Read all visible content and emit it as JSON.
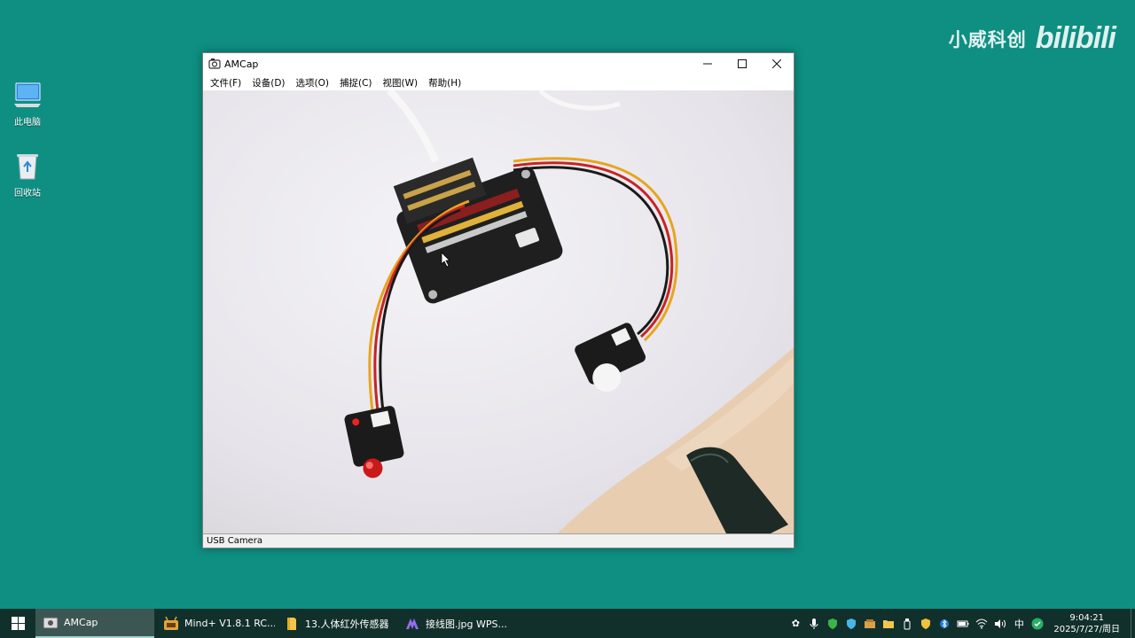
{
  "desktop": {
    "icons": [
      {
        "label": "此电脑",
        "icon": "computer-icon"
      },
      {
        "label": "回收站",
        "icon": "recycle-bin-icon"
      }
    ]
  },
  "watermark": {
    "text": "小威科创",
    "logo": "bilibili"
  },
  "window": {
    "title": "AMCap",
    "menu": [
      "文件(F)",
      "设备(D)",
      "选项(O)",
      "捕捉(C)",
      "视图(W)",
      "帮助(H)"
    ],
    "status": "USB Camera"
  },
  "taskbar": {
    "tasks": [
      {
        "label": "AMCap",
        "icon": "amcap-icon",
        "active": true
      },
      {
        "label": "Mind+ V1.8.1 RC...",
        "icon": "mindplus-icon",
        "active": false
      },
      {
        "label": "13.人体红外传感器",
        "icon": "folder-icon",
        "active": false
      },
      {
        "label": "接线图.jpg  WPS...",
        "icon": "wps-icon",
        "active": false
      }
    ],
    "tray_input": "中",
    "time": "9:04:21",
    "date": "2025/7/27/周日"
  }
}
